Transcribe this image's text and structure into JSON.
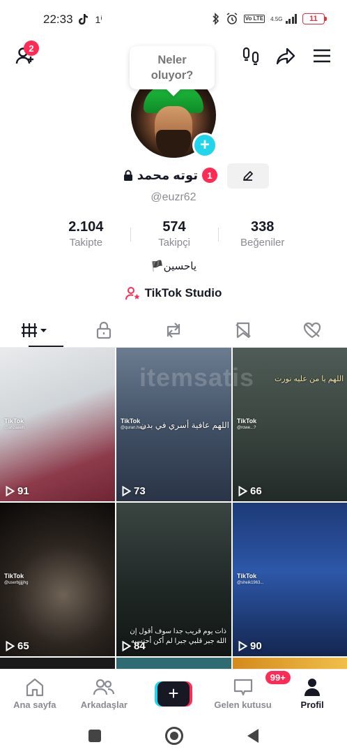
{
  "status_bar": {
    "time": "22:33",
    "extra": "1ⁱ",
    "network": "4.5G",
    "volte": "Vo LTE",
    "battery": "11"
  },
  "top_bar": {
    "add_friends_badge": "2"
  },
  "bubble": {
    "line1": "Neler",
    "line2": "oluyor?"
  },
  "profile": {
    "name": "توته محمد",
    "name_badge": "1",
    "username": "@euzr62",
    "stats": [
      {
        "value": "2.104",
        "label": "Takipte"
      },
      {
        "value": "574",
        "label": "Takipçi"
      },
      {
        "value": "338",
        "label": "Beğeniler"
      }
    ],
    "bio": "🏴یاحسین",
    "studio": "TikTok Studio"
  },
  "watermark": "itemsatis",
  "videos": [
    {
      "views": "91",
      "wm": "TikTok",
      "user": "@ahzaaeh",
      "overlay": ""
    },
    {
      "views": "73",
      "wm": "TikTok",
      "user": "@quran.heart",
      "overlay": "اللهم عافية أسري في بدن"
    },
    {
      "views": "66",
      "wm": "TikTok",
      "user": "@rowe...?",
      "overlay": "اللهم يا من عليه نورت"
    },
    {
      "views": "65",
      "wm": "TikTok",
      "user": "@userbjjjjjhg",
      "overlay": ""
    },
    {
      "views": "84",
      "wm": "",
      "user": "",
      "overlay": "ذات يوم قريب جدا سوف أقول إن الله جبر قلبي جبرا لم أكن أحتسبه"
    },
    {
      "views": "90",
      "wm": "TikTok",
      "user": "@sheik1963...",
      "overlay": ""
    }
  ],
  "bottom_nav": {
    "home": "Ana sayfa",
    "friends": "Arkadaşlar",
    "inbox": "Gelen kutusu",
    "inbox_badge": "99+",
    "profile": "Profil"
  },
  "colors": {
    "brand_red": "#fe2c55",
    "brand_cyan": "#20d5ec",
    "text_primary": "#161823",
    "text_secondary": "#8a8b91"
  }
}
